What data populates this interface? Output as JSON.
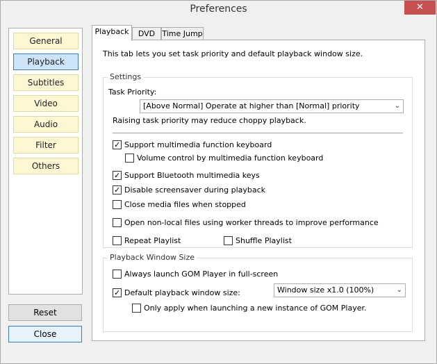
{
  "window": {
    "title": "Preferences",
    "close_glyph": "✕"
  },
  "nav": {
    "items": [
      {
        "label": "General"
      },
      {
        "label": "Playback"
      },
      {
        "label": "Subtitles"
      },
      {
        "label": "Video"
      },
      {
        "label": "Audio"
      },
      {
        "label": "Filter"
      },
      {
        "label": "Others"
      }
    ],
    "active": "Playback"
  },
  "buttons": {
    "reset": "Reset",
    "close": "Close"
  },
  "tabs": [
    {
      "label": "Playback"
    },
    {
      "label": "DVD"
    },
    {
      "label": "Time Jump"
    }
  ],
  "intro": "This tab lets you set task priority and default playback window size.",
  "settings": {
    "group_label": "Settings",
    "task_priority_label": "Task Priority:",
    "task_priority_value": "[Above Normal] Operate at higher than [Normal] priority",
    "priority_note": "Raising task priority may reduce choppy playback.",
    "checkboxes": [
      {
        "label": "Support multimedia function keyboard",
        "checked": true
      },
      {
        "label": "Volume control by multimedia function keyboard",
        "checked": false
      },
      {
        "label": "Support Bluetooth multimedia keys",
        "checked": true
      },
      {
        "label": "Disable screensaver during playback",
        "checked": true
      },
      {
        "label": "Close media files when stopped",
        "checked": false
      },
      {
        "label": "Open non-local files using worker threads to improve performance",
        "checked": false
      },
      {
        "label": "Repeat Playlist",
        "checked": false
      },
      {
        "label": "Shuffle Playlist",
        "checked": false
      }
    ]
  },
  "window_size": {
    "group_label": "Playback Window Size",
    "checkboxes": [
      {
        "label": "Always launch GOM Player in full-screen",
        "checked": false
      },
      {
        "label": "Default playback window size:",
        "checked": true
      },
      {
        "label": "Only apply when launching a new instance of GOM Player.",
        "checked": false
      }
    ],
    "size_value": "Window size x1.0 (100%)"
  }
}
